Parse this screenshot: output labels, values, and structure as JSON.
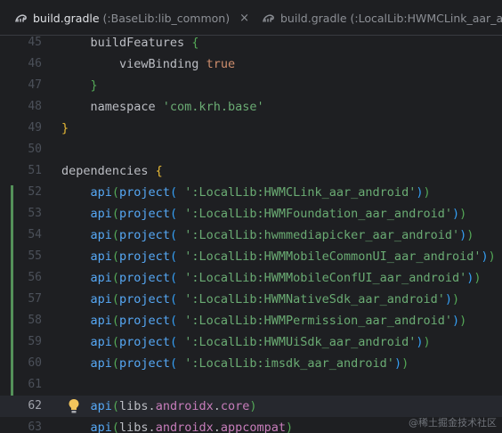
{
  "tabs": [
    {
      "file": "build.gradle",
      "module": "(:BaseLib:lib_common)",
      "active": true,
      "close": "×"
    },
    {
      "file": "build.gradle",
      "module": "(:LocalLib:HWMCLink_aar_android)",
      "active": false
    }
  ],
  "lines": [
    {
      "n": "45",
      "segs": [
        [
          "",
          "    buildFeatures "
        ],
        [
          "b2",
          "{"
        ]
      ]
    },
    {
      "n": "46",
      "segs": [
        [
          "",
          "        viewBinding "
        ],
        [
          "kw",
          "true"
        ]
      ]
    },
    {
      "n": "47",
      "segs": [
        [
          "",
          "    "
        ],
        [
          "b2",
          "}"
        ]
      ]
    },
    {
      "n": "48",
      "segs": [
        [
          "",
          "    namespace "
        ],
        [
          "str",
          "'com.krh.base'"
        ]
      ]
    },
    {
      "n": "49",
      "segs": [
        [
          "b1",
          "}"
        ]
      ]
    },
    {
      "n": "50",
      "segs": []
    },
    {
      "n": "51",
      "segs": [
        [
          "",
          "dependencies "
        ],
        [
          "b1",
          "{"
        ]
      ]
    },
    {
      "n": "52",
      "segs": [
        [
          "",
          "    "
        ],
        [
          "fn",
          "api"
        ],
        [
          "b2",
          "("
        ],
        [
          "fn",
          "project"
        ],
        [
          "b3",
          "("
        ],
        [
          "",
          " "
        ],
        [
          "str",
          "':LocalLib:HWMCLink_aar_android'"
        ],
        [
          "b3",
          ")"
        ],
        [
          "b2",
          ")"
        ]
      ]
    },
    {
      "n": "53",
      "segs": [
        [
          "",
          "    "
        ],
        [
          "fn",
          "api"
        ],
        [
          "b2",
          "("
        ],
        [
          "fn",
          "project"
        ],
        [
          "b3",
          "("
        ],
        [
          "",
          " "
        ],
        [
          "str",
          "':LocalLib:HWMFoundation_aar_android'"
        ],
        [
          "b3",
          ")"
        ],
        [
          "b2",
          ")"
        ]
      ]
    },
    {
      "n": "54",
      "segs": [
        [
          "",
          "    "
        ],
        [
          "fn",
          "api"
        ],
        [
          "b2",
          "("
        ],
        [
          "fn",
          "project"
        ],
        [
          "b3",
          "("
        ],
        [
          "",
          " "
        ],
        [
          "str",
          "':LocalLib:hwmmediapicker_aar_android'"
        ],
        [
          "b3",
          ")"
        ],
        [
          "b2",
          ")"
        ]
      ]
    },
    {
      "n": "55",
      "segs": [
        [
          "",
          "    "
        ],
        [
          "fn",
          "api"
        ],
        [
          "b2",
          "("
        ],
        [
          "fn",
          "project"
        ],
        [
          "b3",
          "("
        ],
        [
          "",
          " "
        ],
        [
          "str",
          "':LocalLib:HWMMobileCommonUI_aar_android'"
        ],
        [
          "b3",
          ")"
        ],
        [
          "b2",
          ")"
        ]
      ]
    },
    {
      "n": "56",
      "segs": [
        [
          "",
          "    "
        ],
        [
          "fn",
          "api"
        ],
        [
          "b2",
          "("
        ],
        [
          "fn",
          "project"
        ],
        [
          "b3",
          "("
        ],
        [
          "",
          " "
        ],
        [
          "str",
          "':LocalLib:HWMMobileConfUI_aar_android'"
        ],
        [
          "b3",
          ")"
        ],
        [
          "b2",
          ")"
        ]
      ]
    },
    {
      "n": "57",
      "segs": [
        [
          "",
          "    "
        ],
        [
          "fn",
          "api"
        ],
        [
          "b2",
          "("
        ],
        [
          "fn",
          "project"
        ],
        [
          "b3",
          "("
        ],
        [
          "",
          " "
        ],
        [
          "str",
          "':LocalLib:HWMNativeSdk_aar_android'"
        ],
        [
          "b3",
          ")"
        ],
        [
          "b2",
          ")"
        ]
      ]
    },
    {
      "n": "58",
      "segs": [
        [
          "",
          "    "
        ],
        [
          "fn",
          "api"
        ],
        [
          "b2",
          "("
        ],
        [
          "fn",
          "project"
        ],
        [
          "b3",
          "("
        ],
        [
          "",
          " "
        ],
        [
          "str",
          "':LocalLib:HWMPermission_aar_android'"
        ],
        [
          "b3",
          ")"
        ],
        [
          "b2",
          ")"
        ]
      ]
    },
    {
      "n": "59",
      "segs": [
        [
          "",
          "    "
        ],
        [
          "fn",
          "api"
        ],
        [
          "b2",
          "("
        ],
        [
          "fn",
          "project"
        ],
        [
          "b3",
          "("
        ],
        [
          "",
          " "
        ],
        [
          "str",
          "':LocalLib:HWMUiSdk_aar_android'"
        ],
        [
          "b3",
          ")"
        ],
        [
          "b2",
          ")"
        ]
      ]
    },
    {
      "n": "60",
      "segs": [
        [
          "",
          "    "
        ],
        [
          "fn",
          "api"
        ],
        [
          "b2",
          "("
        ],
        [
          "fn",
          "project"
        ],
        [
          "b3",
          "("
        ],
        [
          "",
          " "
        ],
        [
          "str",
          "':LocalLib:imsdk_aar_android'"
        ],
        [
          "b3",
          ")"
        ],
        [
          "b2",
          ")"
        ]
      ]
    },
    {
      "n": "61",
      "segs": []
    },
    {
      "n": "62",
      "current": true,
      "bulb": true,
      "segs": [
        [
          "",
          "    "
        ],
        [
          "fn",
          "api"
        ],
        [
          "b2",
          "("
        ],
        [
          "",
          "libs."
        ],
        [
          "pr",
          "androidx"
        ],
        [
          "",
          "."
        ],
        [
          "pr",
          "core"
        ],
        [
          "b2",
          ")"
        ]
      ]
    },
    {
      "n": "63",
      "segs": [
        [
          "",
          "    "
        ],
        [
          "fn",
          "api"
        ],
        [
          "b2",
          "("
        ],
        [
          "",
          "libs."
        ],
        [
          "pr",
          "androidx"
        ],
        [
          "",
          "."
        ],
        [
          "pr",
          "appcompat"
        ],
        [
          "b2",
          ")"
        ]
      ]
    }
  ],
  "watermark": "@稀土掘金技术社区",
  "colors": {
    "background": "#1e1f22",
    "current_line": "#26282e",
    "vcs_added": "#549159",
    "accent": "#3574f0"
  },
  "icons": [
    "gradle-file-icon",
    "close-icon",
    "intention-bulb-icon"
  ]
}
